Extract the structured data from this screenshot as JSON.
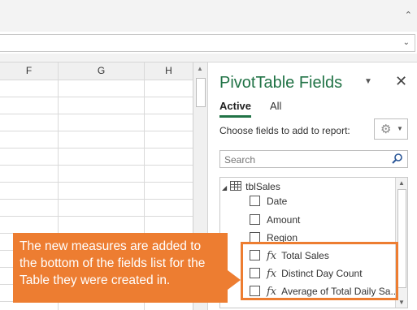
{
  "grid": {
    "columns": [
      {
        "name": "F"
      },
      {
        "name": "G"
      },
      {
        "name": "H"
      }
    ]
  },
  "pane": {
    "title": "PivotTable Fields",
    "tabs": [
      {
        "label": "Active",
        "active": true
      },
      {
        "label": "All",
        "active": false
      }
    ],
    "choose_label": "Choose fields to add to report:",
    "search_placeholder": "Search",
    "table_name": "tblSales",
    "fields": [
      {
        "label": "Date",
        "checked": false,
        "measure": false
      },
      {
        "label": "Amount",
        "checked": false,
        "measure": false
      },
      {
        "label": "Region",
        "checked": false,
        "measure": false
      },
      {
        "label": "Total Sales",
        "checked": false,
        "measure": true
      },
      {
        "label": "Distinct Day Count",
        "checked": false,
        "measure": true
      },
      {
        "label": "Average of Total Daily Sa...",
        "checked": false,
        "measure": true
      }
    ],
    "accent_color": "#217346"
  },
  "callout": {
    "text": "The new measures are added to the bottom of the fields list for the Table they were created in.",
    "color": "#ed7d31"
  },
  "icons": {
    "fx": "fx",
    "pane_menu": "▼",
    "close": "✕",
    "gear": "⚙",
    "caret": "▼"
  }
}
